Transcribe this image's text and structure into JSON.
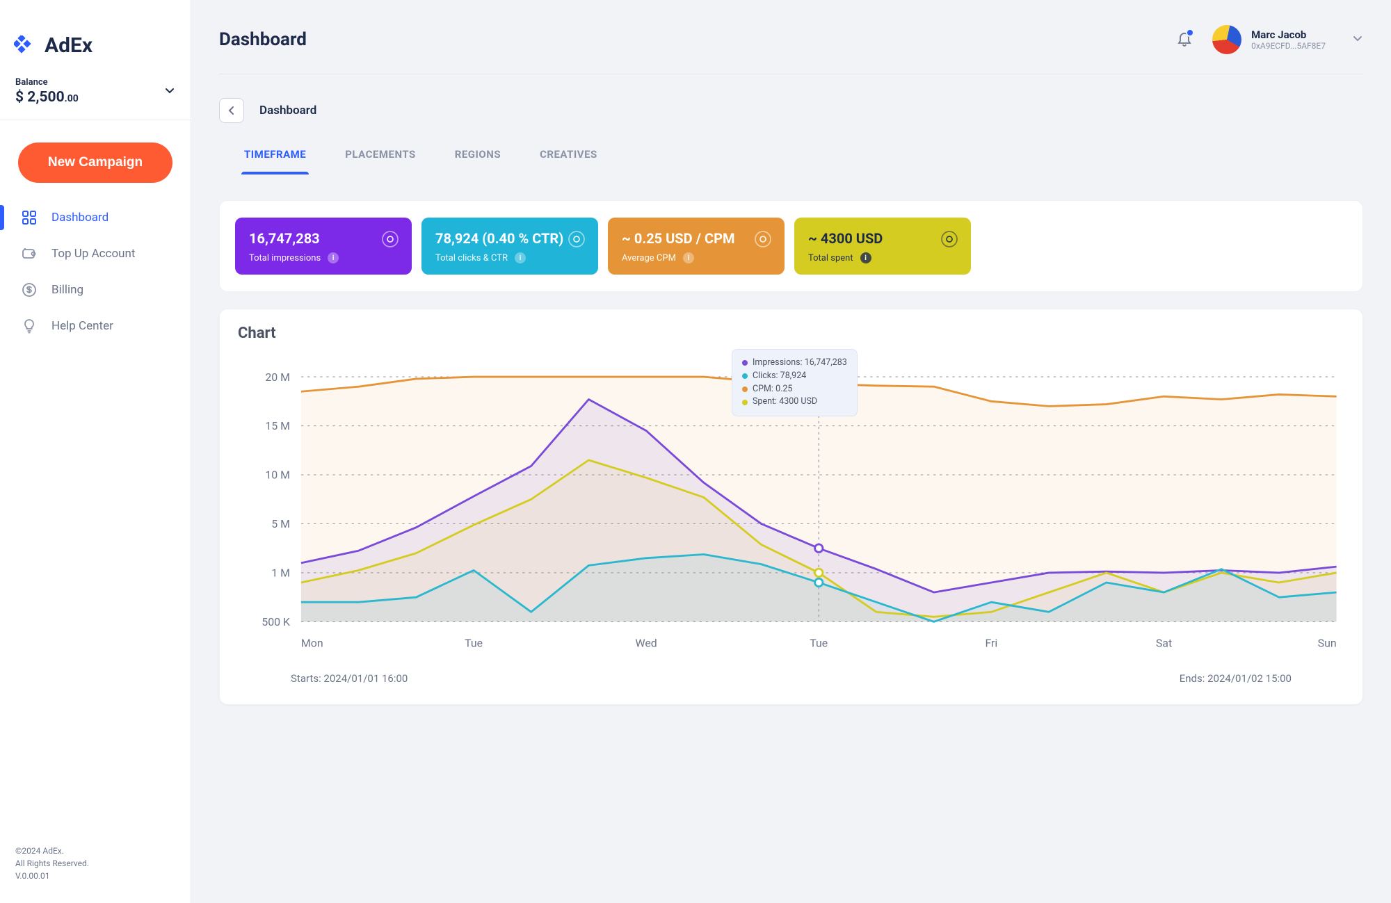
{
  "brand": {
    "name": "AdEx"
  },
  "balance": {
    "label": "Balance",
    "currency": "$ ",
    "whole": "2,500",
    "cents": ".00"
  },
  "actions": {
    "new_campaign": "New Campaign"
  },
  "nav": {
    "items": [
      {
        "label": "Dashboard",
        "icon": "grid"
      },
      {
        "label": "Top Up Account",
        "icon": "wallet"
      },
      {
        "label": "Billing",
        "icon": "dollar"
      },
      {
        "label": "Help Center",
        "icon": "bulb"
      }
    ]
  },
  "footer": {
    "l1": "©2024 AdEx.",
    "l2": "All Rights Reserved.",
    "l3": "V.0.00.01"
  },
  "header": {
    "title": "Dashboard"
  },
  "user": {
    "name": "Marc Jacob",
    "addr": "0xA9ECFD...5AF8E7"
  },
  "crumb": {
    "label": "Dashboard"
  },
  "tabs": [
    "TIMEFRAME",
    "PLACEMENTS",
    "REGIONS",
    "CREATIVES"
  ],
  "stats": [
    {
      "value": "16,747,283",
      "label": "Total impressions",
      "color": "#7c2ae8"
    },
    {
      "value": "78,924 (0.40 % CTR)",
      "label": "Total clicks & CTR",
      "color": "#1fb4d8"
    },
    {
      "value": "~ 0.25 USD / CPM",
      "label": "Average CPM",
      "color": "#e59537"
    },
    {
      "value": "~ 4300 USD",
      "label": "Total spent",
      "color": "#d4cc20",
      "text": "#1e2a4a"
    }
  ],
  "chart": {
    "title": "Chart",
    "start_label": "Starts: 2024/01/01 16:00",
    "end_label": "Ends: 2024/01/02 15:00",
    "tooltip": {
      "items": [
        {
          "color": "#7a4ad9",
          "text": "Impressions: 16,747,283"
        },
        {
          "color": "#2bb8cf",
          "text": "Clicks: 78,924"
        },
        {
          "color": "#e59537",
          "text": "CPM: 0.25"
        },
        {
          "color": "#d4cc20",
          "text": "Spent: 4300 USD"
        }
      ]
    }
  },
  "chart_data": {
    "type": "line",
    "ylabel": "",
    "xlabel": "",
    "yticks": [
      "500 K",
      "1 M",
      "5 M",
      "10 M",
      "15 M",
      "20 M"
    ],
    "ytick_values": [
      500000,
      1000000,
      5000000,
      10000000,
      15000000,
      20000000
    ],
    "x_categories": [
      "Mon",
      "Tue",
      "Wed",
      "Tue",
      "Fri",
      "Sat",
      "Sun"
    ],
    "series": [
      {
        "name": "CPM-line",
        "color": "#e59537",
        "values": [
          18500000,
          19000000,
          19800000,
          20200000,
          20400000,
          20500000,
          20500000,
          20200000,
          19500000,
          19300000,
          19100000,
          19000000,
          17500000,
          17000000,
          17200000,
          18000000,
          17700000,
          18200000,
          18000000
        ]
      },
      {
        "name": "Impressions",
        "color": "#7a4ad9",
        "values": [
          1800000,
          2800000,
          4700000,
          7800000,
          10900000,
          17700000,
          14500000,
          9200000,
          5000000,
          3000000,
          1300000,
          800000,
          900000,
          1000000,
          1100000,
          1000000,
          1200000,
          1000000,
          1500000
        ]
      },
      {
        "name": "Spent",
        "color": "#d4cc20",
        "values": [
          900000,
          1200000,
          2600000,
          4900000,
          7500000,
          11500000,
          9700000,
          7700000,
          3300000,
          1000000,
          600000,
          550000,
          600000,
          800000,
          1000000,
          800000,
          1000000,
          900000,
          1000000
        ]
      },
      {
        "name": "Clicks",
        "color": "#2bb8cf",
        "values": [
          700000,
          700000,
          750000,
          1200000,
          600000,
          1600000,
          2200000,
          2500000,
          1700000,
          900000,
          700000,
          500000,
          700000,
          600000,
          900000,
          800000,
          1300000,
          750000,
          800000
        ]
      }
    ],
    "marker_index": 9
  }
}
